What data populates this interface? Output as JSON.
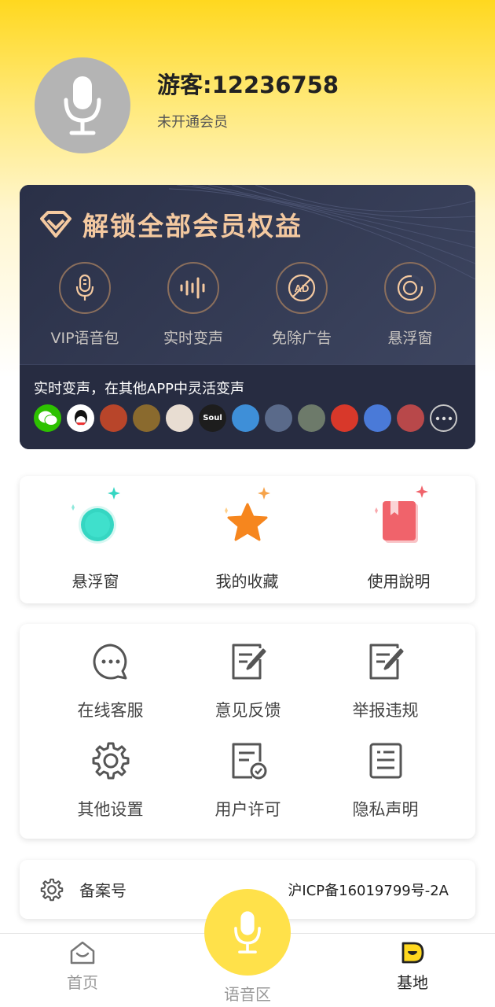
{
  "profile": {
    "username": "游客:12236758",
    "status": "未开通会员",
    "avatar_icon": "microphone-icon"
  },
  "vip": {
    "title": "解锁全部会员权益",
    "title_color": "#F4C9A0",
    "features": [
      {
        "label": "VIP语音包",
        "icon": "microphone-icon"
      },
      {
        "label": "实时变声",
        "icon": "sound-wave-icon"
      },
      {
        "label": "免除广告",
        "icon": "no-ad-icon"
      },
      {
        "label": "悬浮窗",
        "icon": "floating-window-icon"
      }
    ],
    "subtitle": "实时变声，在其他APP中灵活变声",
    "apps": [
      {
        "name": "wechat-icon",
        "text": "",
        "color": "#2DC100"
      },
      {
        "name": "qq-icon",
        "text": "",
        "color": "#ffffff"
      },
      {
        "name": "game-icon-1",
        "text": "",
        "color": "#b8452a"
      },
      {
        "name": "game-icon-2",
        "text": "",
        "color": "#8a6a2e"
      },
      {
        "name": "game-icon-3",
        "text": "",
        "color": "#e8ddd2"
      },
      {
        "name": "soul-icon",
        "text": "Soul",
        "color": "#1d1d1d"
      },
      {
        "name": "game-icon-4",
        "text": "",
        "color": "#3e8fd8"
      },
      {
        "name": "game-icon-5",
        "text": "",
        "color": "#5a6a8a"
      },
      {
        "name": "game-icon-6",
        "text": "",
        "color": "#6d7a6a"
      },
      {
        "name": "game-icon-7",
        "text": "",
        "color": "#d8382a"
      },
      {
        "name": "game-icon-8",
        "text": "",
        "color": "#4a7ad8"
      },
      {
        "name": "game-icon-9",
        "text": "",
        "color": "#b8484a"
      }
    ]
  },
  "quick": [
    {
      "label": "悬浮窗",
      "icon": "floating-ball-icon"
    },
    {
      "label": "我的收藏",
      "icon": "star-icon"
    },
    {
      "label": "使用說明",
      "icon": "book-icon"
    }
  ],
  "services": [
    {
      "label": "在线客服",
      "icon": "chat-bubble-icon"
    },
    {
      "label": "意见反馈",
      "icon": "feedback-icon"
    },
    {
      "label": "举报违规",
      "icon": "report-icon"
    },
    {
      "label": "其他设置",
      "icon": "gear-icon"
    },
    {
      "label": "用户许可",
      "icon": "license-icon"
    },
    {
      "label": "隐私声明",
      "icon": "privacy-icon"
    }
  ],
  "record": {
    "label": "备案号",
    "value": "沪ICP备16019799号-2A"
  },
  "tabbar": {
    "home": "首页",
    "voice": "语音区",
    "base": "基地"
  },
  "colors": {
    "accent_yellow": "#FFD81F",
    "vip_bg": "#2c3247",
    "teal": "#35d6c2",
    "orange": "#f6861e",
    "red": "#f0636b"
  }
}
